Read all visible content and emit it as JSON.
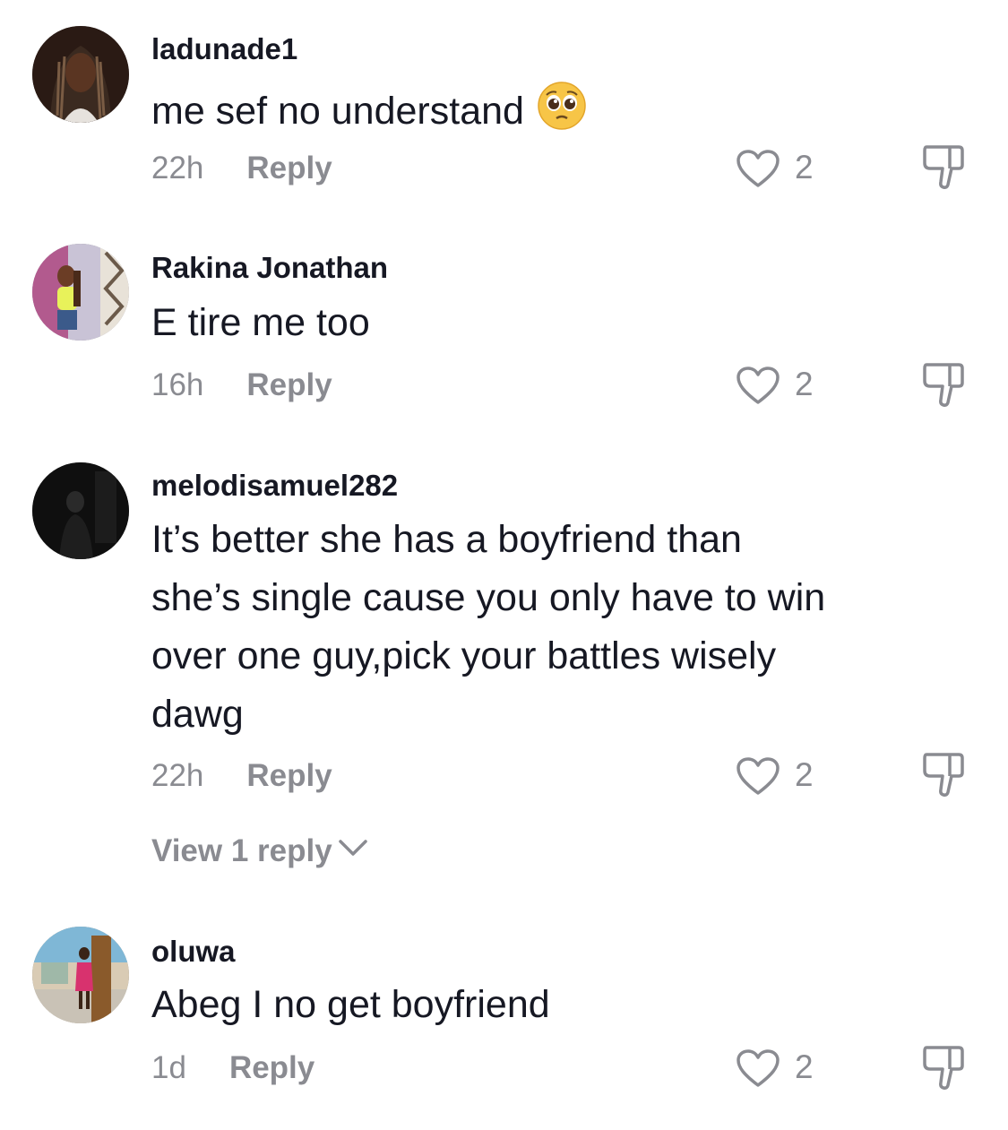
{
  "comments": [
    {
      "username": "ladunade1",
      "text": "me sef no understand",
      "emoji": "pleading-face-emoji",
      "time": "22h",
      "reply_label": "Reply",
      "likes": "2",
      "avatar_colors": {
        "bg": "#2a1a14",
        "skin": "#5a3522",
        "hair": "#3b2a20"
      }
    },
    {
      "username": "Rakina Jonathan",
      "text": "E tire me too",
      "time": "16h",
      "reply_label": "Reply",
      "likes": "2",
      "avatar_colors": {
        "bg": "#c9c3d6",
        "skin": "#6b3d25",
        "top": "#e8f25a"
      }
    },
    {
      "username": "melodisamuel282",
      "text": "It’s better she has a boyfriend than she’s single cause you only have to win over one guy,pick your battles wisely dawg",
      "time": "22h",
      "reply_label": "Reply",
      "likes": "2",
      "view_replies": "View 1 reply",
      "avatar_colors": {
        "bg": "#0f0f0f",
        "figure": "#2a2a2a"
      }
    },
    {
      "username": "oluwa",
      "text": "Abeg I no get boyfriend",
      "time": "1d",
      "reply_label": "Reply",
      "likes": "2",
      "avatar_colors": {
        "bg": "#d9cbb4",
        "pillar": "#8a5a2b",
        "dress": "#d8326e"
      }
    }
  ],
  "colors": {
    "text": "#161823",
    "muted": "#8a8b91"
  }
}
